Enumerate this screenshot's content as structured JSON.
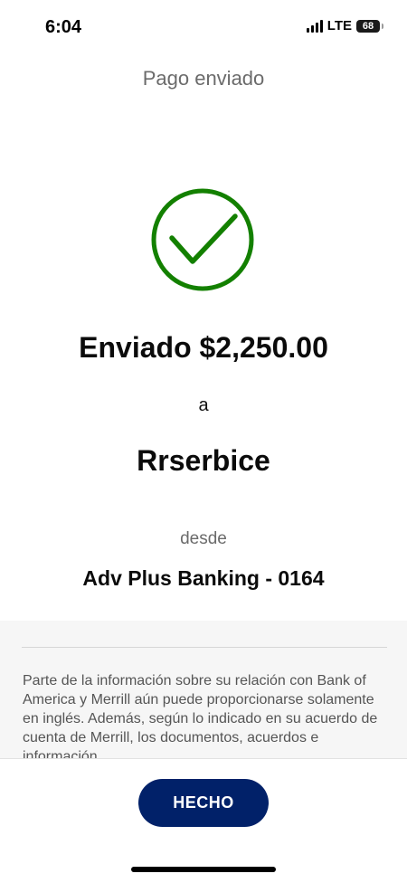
{
  "status_bar": {
    "time": "6:04",
    "network": "LTE",
    "battery": "68"
  },
  "header": {
    "title": "Pago enviado"
  },
  "confirmation": {
    "icon": "checkmark-circle-icon",
    "accent_color": "#138000",
    "amount_line": "Enviado $2,250.00",
    "to_word": "a",
    "recipient": "Rrserbice",
    "from_word": "desde",
    "account": "Adv Plus Banking - 0164"
  },
  "disclaimer": {
    "text": "Parte de la información sobre su relación con Bank of America y Merrill aún puede proporcionarse solamente en inglés. Además, según lo indicado en su acuerdo de cuenta de Merrill, los documentos, acuerdos e información"
  },
  "footer": {
    "done_label": "HECHO",
    "button_color": "#012169"
  }
}
